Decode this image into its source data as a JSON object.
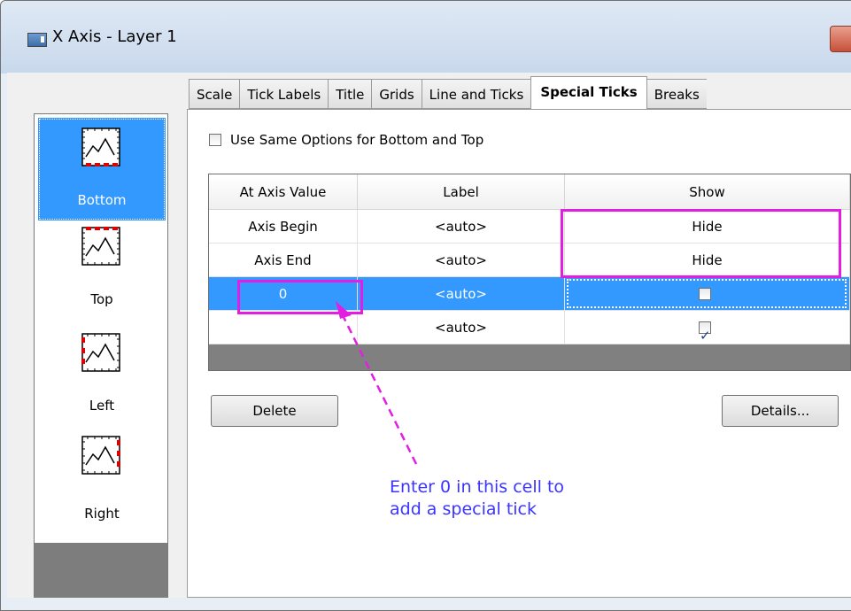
{
  "window": {
    "title": "X Axis - Layer 1"
  },
  "sidebar": {
    "items": [
      {
        "label": "Bottom",
        "selected": true
      },
      {
        "label": "Top",
        "selected": false
      },
      {
        "label": "Left",
        "selected": false
      },
      {
        "label": "Right",
        "selected": false
      }
    ]
  },
  "tabs": [
    "Scale",
    "Tick Labels",
    "Title",
    "Grids",
    "Line and Ticks",
    "Special Ticks",
    "Breaks"
  ],
  "active_tab": "Special Ticks",
  "options": {
    "same_options_label": "Use Same Options for Bottom and Top",
    "same_options_checked": false
  },
  "grid": {
    "headers": [
      "At Axis Value",
      "Label",
      "Show"
    ],
    "rows": [
      {
        "value": "Axis Begin",
        "label": "<auto>",
        "show": "Hide"
      },
      {
        "value": "Axis End",
        "label": "<auto>",
        "show": "Hide"
      },
      {
        "value": "0",
        "label": "<auto>",
        "show_checked": false,
        "selected": true
      },
      {
        "value": "",
        "label": "<auto>",
        "show_checked": true
      }
    ]
  },
  "buttons": {
    "delete": "Delete",
    "details": "Details..."
  },
  "annotation": {
    "line1": "Enter 0 in this cell to",
    "line2": "add a special tick"
  },
  "colors": {
    "selection": "#3399ff",
    "annotation_box": "#e31ee3",
    "annotation_text": "#3b33ff"
  }
}
